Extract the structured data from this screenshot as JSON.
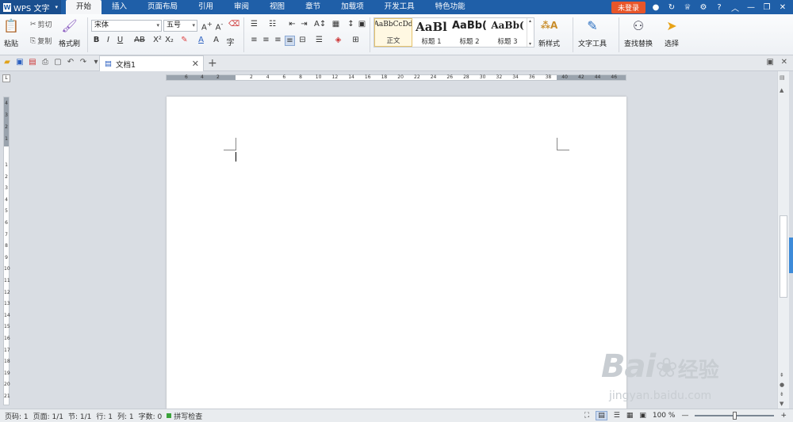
{
  "app": {
    "name": "WPS 文字"
  },
  "menu": [
    "开始",
    "插入",
    "页面布局",
    "引用",
    "审阅",
    "视图",
    "章节",
    "加载项",
    "开发工具",
    "特色功能"
  ],
  "titlebar": {
    "login_label": "未登录",
    "help_label": "?"
  },
  "ribbon": {
    "paste": "粘贴",
    "cut": "剪切",
    "copy": "复制",
    "format_painter": "格式刷",
    "font_name": "宋体",
    "font_size": "五号",
    "styles": [
      {
        "preview": "AaBbCcDd",
        "name": "正文"
      },
      {
        "preview": "AaBl",
        "name": "标题 1"
      },
      {
        "preview": "AaBb(",
        "name": "标题 2"
      },
      {
        "preview": "AaBb(",
        "name": "标题 3"
      }
    ],
    "new_style": "新样式",
    "text_tools": "文字工具",
    "find_replace": "查找替换",
    "select": "选择"
  },
  "tabs": {
    "document": "文档1"
  },
  "ruler": {
    "h_left": [
      "6",
      "4",
      "2"
    ],
    "h_right": [
      "2",
      "4",
      "6",
      "8",
      "10",
      "12",
      "14",
      "16",
      "18",
      "20",
      "22",
      "24",
      "26",
      "28",
      "30",
      "32",
      "34",
      "36",
      "38",
      "40",
      "42",
      "44",
      "46"
    ],
    "v_top": [
      "4",
      "3",
      "2",
      "1"
    ],
    "v_body": [
      "1",
      "2",
      "3",
      "4",
      "5",
      "6",
      "7",
      "8",
      "9",
      "10",
      "11",
      "12",
      "13",
      "14",
      "15",
      "16",
      "17",
      "18",
      "19",
      "20",
      "21"
    ]
  },
  "status": {
    "page_num": "页码: 1",
    "pages": "页面: 1/1",
    "section": "节: 1/1",
    "row": "行: 1",
    "col": "列: 1",
    "words": "字数: 0",
    "spell_check": "拼写检查",
    "zoom": "100 %",
    "zoom_level": 0.5
  },
  "watermark": {
    "main": "Bai",
    "brand": "经验",
    "url": "jingyan.baidu.com"
  }
}
